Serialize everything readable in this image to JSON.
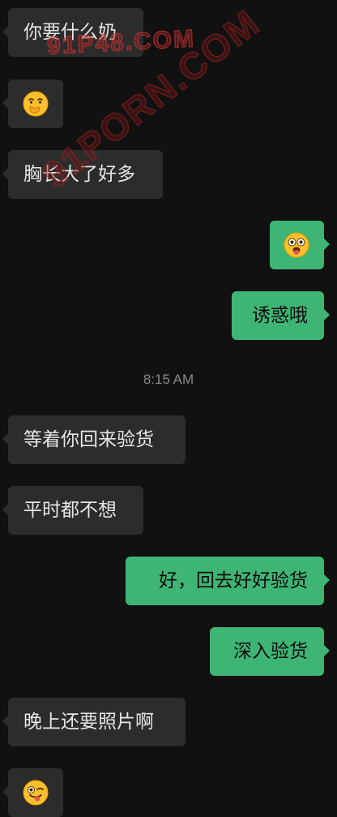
{
  "messages": [
    {
      "side": "in",
      "text": "你要什么奶"
    },
    {
      "side": "in",
      "emoji": "thinking-hand-over-mouth-emoji"
    },
    {
      "side": "in",
      "text": "胸长大了好多"
    },
    {
      "side": "out",
      "emoji": "flushed-tongue-emoji"
    },
    {
      "side": "out",
      "text": "诱惑哦"
    },
    {
      "side": "in",
      "text": "等着你回来验货"
    },
    {
      "side": "in",
      "text": "平时都不想"
    },
    {
      "side": "out",
      "text": "好，回去好好验货"
    },
    {
      "side": "out",
      "text": "深入验货"
    },
    {
      "side": "in",
      "text": "晚上还要照片啊"
    },
    {
      "side": "in",
      "emoji": "winking-tongue-emoji"
    }
  ],
  "timestamp": "8:15 AM",
  "watermarks": [
    "91P48.COM",
    "91PORN.COM"
  ],
  "colors": {
    "background": "#111111",
    "incoming_bubble": "#2c2c2c",
    "outgoing_bubble": "#3eb575",
    "incoming_text": "#e6e6e6",
    "outgoing_text": "#0c0c0c",
    "timestamp_text": "#8a8a8a"
  }
}
